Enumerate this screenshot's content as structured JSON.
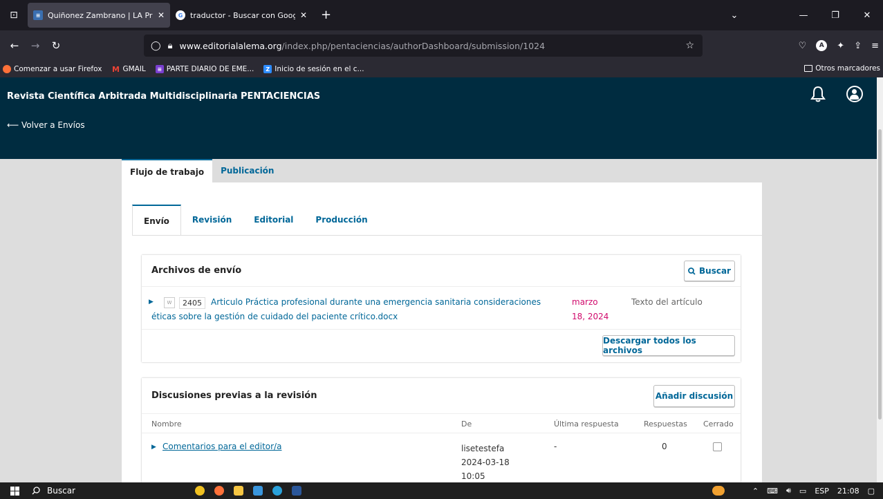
{
  "browser": {
    "tabs": [
      {
        "title": "Quiñonez Zambrano | LA Práctica",
        "active": true
      },
      {
        "title": "traductor - Buscar con Google",
        "active": false
      }
    ],
    "new_tab": "+",
    "url_domain": "www.editorialalema.org",
    "url_path": "/index.php/pentaciencias/authorDashboard/submission/1024",
    "bookmarks": [
      {
        "label": "Comenzar a usar Firefox",
        "icon": "firefox-icon"
      },
      {
        "label": "GMAIL",
        "icon": "gmail-icon"
      },
      {
        "label": "PARTE DIARIO DE EME...",
        "icon": "list-icon"
      },
      {
        "label": "Inicio de sesión en el c...",
        "icon": "z-icon"
      }
    ],
    "other_bookmarks": "Otros marcadores",
    "colors": {
      "tabstrip": "#1c1b22",
      "toolbar": "#2b2a33"
    }
  },
  "app": {
    "title": "Revista Científica Arbitrada Multidisciplinaria PENTACIENCIAS",
    "back_link": "⟵ Volver a Envíos",
    "colors": {
      "header": "#002c40",
      "link": "#006798",
      "date": "#d00a6c"
    }
  },
  "main_tabs": [
    {
      "label": "Flujo de trabajo",
      "active": true
    },
    {
      "label": "Publicación",
      "active": false
    }
  ],
  "sub_tabs": [
    {
      "label": "Envío",
      "active": true
    },
    {
      "label": "Revisión",
      "active": false
    },
    {
      "label": "Editorial",
      "active": false
    },
    {
      "label": "Producción",
      "active": false
    }
  ],
  "files_card": {
    "title": "Archivos de envío",
    "search_button": "Buscar",
    "files": [
      {
        "id": "2405",
        "name": "Articulo Práctica profesional durante una emergencia sanitaria consideraciones éticas sobre la gestión de cuidado del paciente crítico.docx",
        "date": "marzo 18, 2024",
        "type": "Texto del artículo"
      }
    ],
    "download_all": "Descargar todos los archivos"
  },
  "discussions_card": {
    "title": "Discusiones previas a la revisión",
    "add_button": "Añadir discusión",
    "columns": [
      "Nombre",
      "De",
      "Última respuesta",
      "Respuestas",
      "Cerrado"
    ],
    "rows": [
      {
        "name": "Comentarios para el editor/a",
        "from_user": "lisetestefa",
        "from_date": "2024-03-18",
        "from_time": "10:05",
        "last_reply": "-",
        "replies": "0",
        "closed": false
      }
    ]
  },
  "taskbar": {
    "search": "Buscar",
    "lang": "ESP",
    "time": "21:08"
  }
}
